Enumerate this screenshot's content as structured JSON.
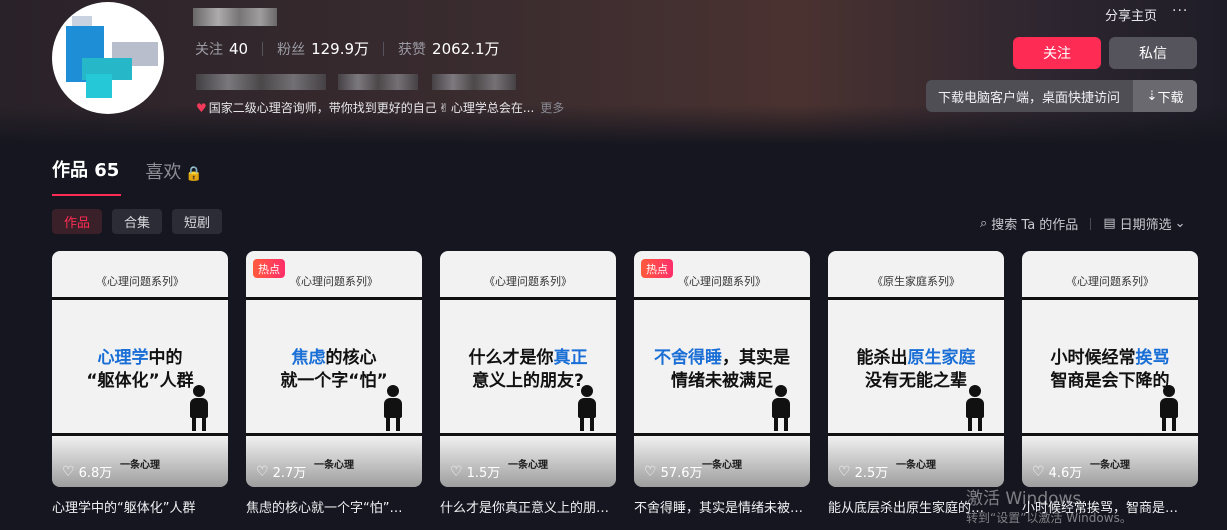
{
  "profile": {
    "stats": [
      {
        "label": "关注",
        "value": "40"
      },
      {
        "label": "粉丝",
        "value": "129.9万"
      },
      {
        "label": "获赞",
        "value": "2062.1万"
      }
    ],
    "bio": "国家二级心理咨询师，带你找到更好的自己",
    "bio_tail": "心理学总会在...",
    "more_label": "更多",
    "heart_glyph": "♥",
    "hand_glyph": "✌"
  },
  "header": {
    "share_label": "分享主页",
    "more_glyph": "···",
    "follow_label": "关注",
    "message_label": "私信",
    "download_text": "下载电脑客户端，桌面快捷访问",
    "download_button": "下载",
    "download_icon": "⇣"
  },
  "tabs": [
    {
      "label": "作品 65"
    },
    {
      "label": "喜欢",
      "lock_glyph": "🔒"
    }
  ],
  "filters": [
    {
      "label": "作品"
    },
    {
      "label": "合集"
    },
    {
      "label": "短剧"
    }
  ],
  "toolbar": {
    "search_icon": "⌕",
    "search_label": "搜索 Ta 的作品",
    "date_icon": "▤",
    "date_label": "日期筛选",
    "chevron": "⌄"
  },
  "videos": [
    {
      "series": "《心理问题系列》",
      "line1": "心理学中的",
      "line2": "“躯体化”人群",
      "hl1": "心理学",
      "brand": "一条心理",
      "likes": "6.8万",
      "caption": "心理学中的“躯体化”人群",
      "hot": false
    },
    {
      "series": "《心理问题系列》",
      "line1": "焦虑的核心",
      "line2": "就一个字“怕”",
      "hl1": "焦虑",
      "brand": "一条心理",
      "likes": "2.7万",
      "caption": "焦虑的核心就一个字“怕”…",
      "hot": true,
      "hot_label": "热点"
    },
    {
      "series": "《心理问题系列》",
      "line1": "什么才是你真正",
      "line2": "意义上的朋友?",
      "hl1": "真正",
      "brand": "一条心理",
      "likes": "1.5万",
      "caption": "什么才是你真正意义上的朋友…",
      "hot": false
    },
    {
      "series": "《心理问题系列》",
      "line1": "不舍得睡，其实是",
      "line2": "情绪未被满足",
      "hl1": "不舍得睡",
      "brand": "一条心理",
      "likes": "57.6万",
      "caption": "不舍得睡，其实是情绪未被满足…",
      "hot": true,
      "hot_label": "热点"
    },
    {
      "series": "《原生家庭系列》",
      "line1": "能杀出原生家庭",
      "line2": "没有无能之辈",
      "hl1": "原生家庭",
      "brand": "一条心理",
      "likes": "2.5万",
      "caption": "能从底层杀出原生家庭的…",
      "hot": false
    },
    {
      "series": "《心理问题系列》",
      "line1": "小时候经常挨骂",
      "line2": "智商是会下降的",
      "hl1": "挨骂",
      "brand": "一条心理",
      "likes": "4.6万",
      "caption": "小时候经常挨骂，智商是…",
      "hot": false
    }
  ],
  "watermark": {
    "line1": "激活 Windows",
    "line2": "转到“设置”以激活 Windows。"
  }
}
